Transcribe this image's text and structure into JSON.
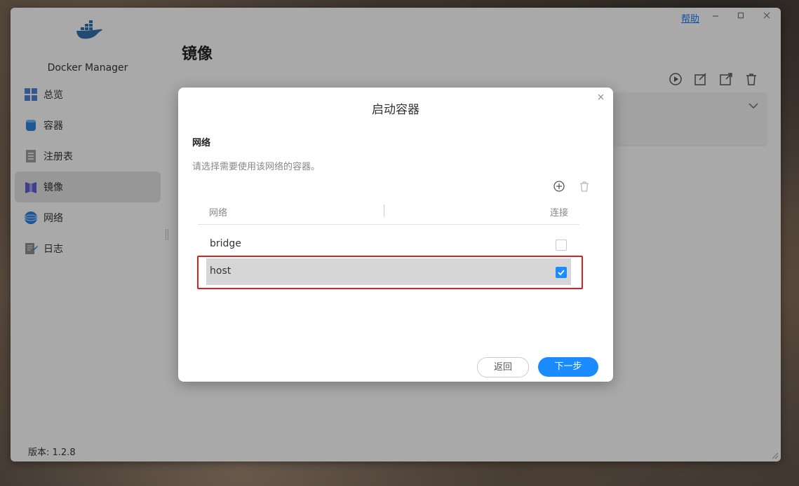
{
  "window": {
    "help_label": "帮助",
    "minimize_icon": "minimize-icon",
    "maximize_icon": "maximize-icon",
    "close_icon": "close-icon"
  },
  "sidebar": {
    "app_name": "Docker Manager",
    "items": [
      {
        "label": "总览",
        "icon": "overview-icon",
        "active": false
      },
      {
        "label": "容器",
        "icon": "container-icon",
        "active": false
      },
      {
        "label": "注册表",
        "icon": "registry-icon",
        "active": false
      },
      {
        "label": "镜像",
        "icon": "image-icon",
        "active": true
      },
      {
        "label": "网络",
        "icon": "network-icon",
        "active": false
      },
      {
        "label": "日志",
        "icon": "log-icon",
        "active": false
      }
    ],
    "version": "版本: 1.2.8"
  },
  "main": {
    "title": "镜像",
    "toolbar_icons": [
      "play-icon",
      "edit-icon",
      "export-icon",
      "trash-icon"
    ]
  },
  "dialog": {
    "title": "启动容器",
    "section_title": "网络",
    "section_desc": "请选择需要使用该网络的容器。",
    "table": {
      "headers": {
        "network": "网络",
        "connect": "连接"
      },
      "rows": [
        {
          "name": "bridge",
          "connected": false
        },
        {
          "name": "host",
          "connected": true
        }
      ]
    },
    "back_label": "返回",
    "next_label": "下一步"
  },
  "colors": {
    "accent": "#1a8cff",
    "highlight": "#e02020"
  }
}
